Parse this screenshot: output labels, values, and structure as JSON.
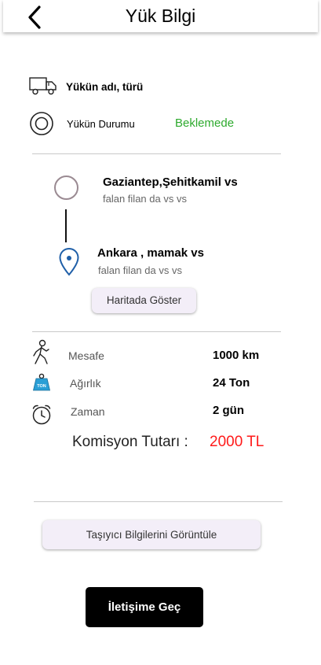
{
  "header": {
    "title": "Yük Bilgi"
  },
  "cargo": {
    "name_label": "Yükün adı, türü"
  },
  "status": {
    "label": "Yükün Durumu",
    "value": "Beklemede"
  },
  "route": {
    "origin": {
      "title": "Gaziantep,Şehitkamil vs",
      "detail": "falan filan da vs vs"
    },
    "destination": {
      "title": "Ankara , mamak vs",
      "detail": "falan filan da vs vs"
    },
    "map_button": "Haritada Göster"
  },
  "specs": {
    "distance": {
      "label": "Mesafe",
      "value": "1000 km"
    },
    "weight": {
      "label": "Ağırlık",
      "value": "24 Ton",
      "badge": "TON"
    },
    "time": {
      "label": "Zaman",
      "value": "2 gün"
    }
  },
  "commission": {
    "label": "Komisyon Tutarı :",
    "value": "2000 TL"
  },
  "carrier_button": "Taşıyıcı Bilgilerini Görüntüle",
  "contact_button": "İletişime Geç",
  "colors": {
    "status": "#2eaa2e",
    "commission": "#ff1a1a",
    "pin": "#1f5fa8",
    "origin_circle": "#9a8a92"
  }
}
